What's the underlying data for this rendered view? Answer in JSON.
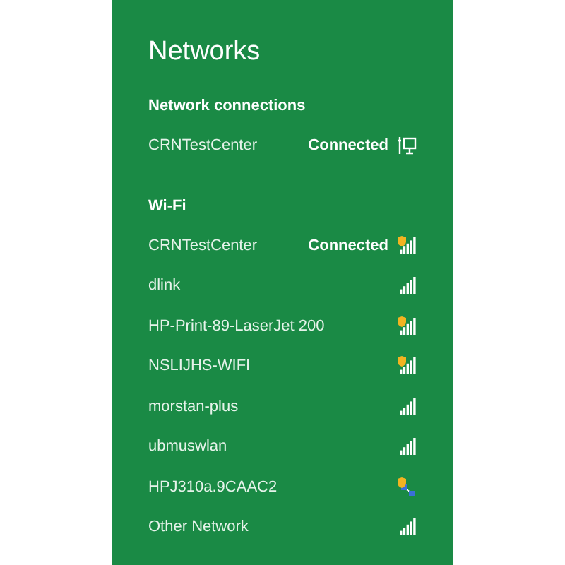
{
  "title": "Networks",
  "sections": [
    {
      "heading": "Network connections",
      "networks": [
        {
          "name": "CRNTestCenter",
          "status": "Connected",
          "kind": "wired"
        }
      ]
    },
    {
      "heading": "Wi-Fi",
      "networks": [
        {
          "name": "CRNTestCenter",
          "status": "Connected",
          "kind": "wifi",
          "warning": true
        },
        {
          "name": "dlink",
          "kind": "wifi",
          "warning": false
        },
        {
          "name": "HP-Print-89-LaserJet 200",
          "kind": "wifi",
          "warning": true
        },
        {
          "name": "NSLIJHS-WIFI",
          "kind": "wifi",
          "warning": true
        },
        {
          "name": "morstan-plus",
          "kind": "wifi",
          "warning": false
        },
        {
          "name": "ubmuswlan",
          "kind": "wifi",
          "warning": false
        },
        {
          "name": "HPJ310a.9CAAC2",
          "kind": "adhoc",
          "warning": true
        },
        {
          "name": "Other Network",
          "kind": "wifi",
          "warning": false
        }
      ]
    }
  ]
}
